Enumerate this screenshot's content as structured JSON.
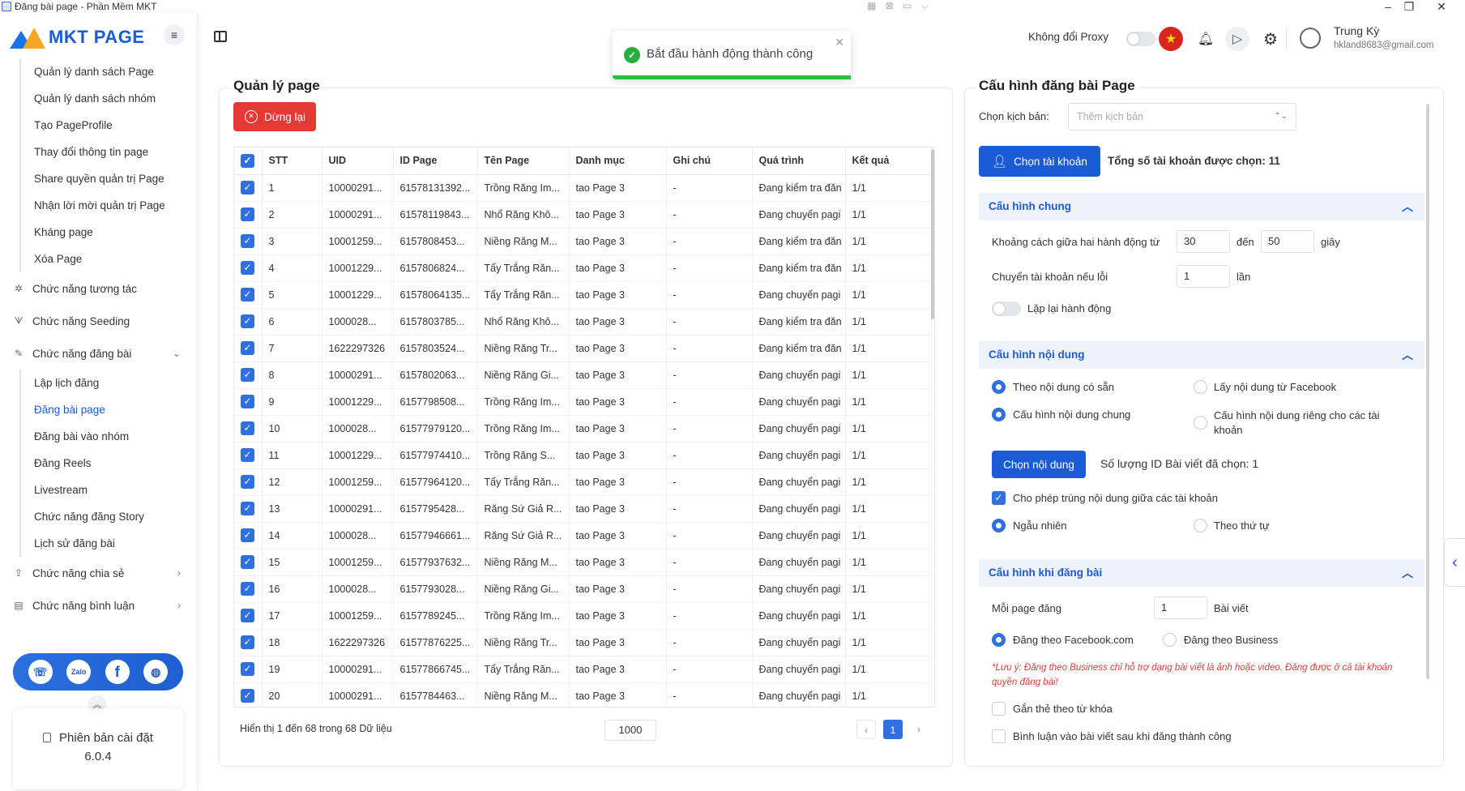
{
  "window": {
    "title": "Đăng bài page - Phần Mềm MKT",
    "minimize": "–",
    "maximize": "❐",
    "close": "✕"
  },
  "sidebar": {
    "logo_text": "MKT PAGE",
    "top_items": [
      {
        "label": "Quản lý danh sách Page"
      },
      {
        "label": "Quản lý danh sách nhóm"
      },
      {
        "label": "Tạo PageProfile"
      },
      {
        "label": "Thay đổi thông tin page"
      },
      {
        "label": "Share quyền quản trị Page"
      },
      {
        "label": "Nhận lời mời quản trị Page"
      },
      {
        "label": "Kháng page"
      },
      {
        "label": "Xóa Page"
      }
    ],
    "groups": {
      "interact": "Chức năng tương tác",
      "seeding": "Chức năng Seeding",
      "posting": "Chức năng đăng bài",
      "share": "Chức năng chia sẻ",
      "comment": "Chức năng bình luận"
    },
    "posting_items": [
      {
        "label": "Lập lịch đăng"
      },
      {
        "label": "Đăng bài page"
      },
      {
        "label": "Đăng bài vào nhóm"
      },
      {
        "label": "Đăng Reels"
      },
      {
        "label": "Livestream"
      },
      {
        "label": "Chức năng đăng Story"
      },
      {
        "label": "Lịch sử đăng bài"
      }
    ],
    "social": {
      "zalo": "Zalo"
    },
    "version_label": "Phiên bản cài đặt",
    "version": "6.0.4"
  },
  "header": {
    "proxy_label": "Không đổi Proxy",
    "user_name": "Trung Kỳ",
    "user_email": "hkland8683@gmail.com"
  },
  "toast": {
    "message": "Bắt đầu hành động thành công",
    "progress": 1.0
  },
  "left_panel": {
    "title": "Quản lý page",
    "stop_button": "Dừng lại",
    "columns": [
      "STT",
      "UID",
      "ID Page",
      "Tên Page",
      "Danh mục",
      "Ghi chú",
      "Quá trình",
      "Kết quả"
    ],
    "rows": [
      [
        "1",
        "10000291...",
        "61578131392...",
        "Trồng Răng Im...",
        "tao Page 3",
        "-",
        "Đang kiểm tra đăn",
        "1/1"
      ],
      [
        "2",
        "10000291...",
        "61578119843...",
        "Nhổ Răng Khô...",
        "tao Page 3",
        "-",
        "Đang chuyển pagi",
        "1/1"
      ],
      [
        "3",
        "10001259...",
        "6157808453...",
        "Niềng Răng M...",
        "tao Page 3",
        "-",
        "Đang kiểm tra đăn",
        "1/1"
      ],
      [
        "4",
        "10001229...",
        "6157806824...",
        "Tẩy Trắng Răn...",
        "tao Page 3",
        "-",
        "Đang kiểm tra đăn",
        "1/1"
      ],
      [
        "5",
        "10001229...",
        "61578064135...",
        "Tẩy Trắng Răn...",
        "tao Page 3",
        "-",
        "Đang chuyển pagi",
        "1/1"
      ],
      [
        "6",
        "1000028...",
        "6157803785...",
        "Nhổ Răng Khô...",
        "tao Page 3",
        "-",
        "Đang kiểm tra đăn",
        "1/1"
      ],
      [
        "7",
        "1622297326",
        "6157803524...",
        "Niềng Răng Tr...",
        "tao Page 3",
        "-",
        "Đang kiểm tra đăn",
        "1/1"
      ],
      [
        "8",
        "10000291...",
        "6157802063...",
        "Niềng Răng Gi...",
        "tao Page 3",
        "-",
        "Đang chuyển pagi",
        "1/1"
      ],
      [
        "9",
        "10001229...",
        "6157798508...",
        "Trồng Răng Im...",
        "tao Page 3",
        "-",
        "Đang chuyển pagi",
        "1/1"
      ],
      [
        "10",
        "1000028...",
        "61577979120...",
        "Trồng Răng Im...",
        "tao Page 3",
        "-",
        "Đang chuyển pagi",
        "1/1"
      ],
      [
        "11",
        "10001229...",
        "61577974410...",
        "Trồng Răng S...",
        "tao Page 3",
        "-",
        "Đang chuyển pagi",
        "1/1"
      ],
      [
        "12",
        "10001259...",
        "61577964120...",
        "Tẩy Trắng Răn...",
        "tao Page 3",
        "-",
        "Đang chuyển pagi",
        "1/1"
      ],
      [
        "13",
        "10000291...",
        "6157795428...",
        "Răng Sứ Giả R...",
        "tao Page 3",
        "-",
        "Đang chuyển pagi",
        "1/1"
      ],
      [
        "14",
        "1000028...",
        "61577946661...",
        "Răng Sứ Giả R...",
        "tao Page 3",
        "-",
        "Đang chuyển pagi",
        "1/1"
      ],
      [
        "15",
        "10001259...",
        "61577937632...",
        "Niềng Răng M...",
        "tao Page 3",
        "-",
        "Đang chuyển pagi",
        "1/1"
      ],
      [
        "16",
        "1000028...",
        "6157793028...",
        "Niềng Răng Gi...",
        "tao Page 3",
        "-",
        "Đang chuyển pagi",
        "1/1"
      ],
      [
        "17",
        "10001259...",
        "6157789245...",
        "Trồng Răng Im...",
        "tao Page 3",
        "-",
        "Đang chuyển pagi",
        "1/1"
      ],
      [
        "18",
        "1622297326",
        "61577876225...",
        "Niềng Răng Tr...",
        "tao Page 3",
        "-",
        "Đang chuyển pagi",
        "1/1"
      ],
      [
        "19",
        "10000291...",
        "61577866745...",
        "Tẩy Trắng Răn...",
        "tao Page 3",
        "-",
        "Đang chuyển pagi",
        "1/1"
      ],
      [
        "20",
        "10000291...",
        "6157784463...",
        "Niềng Răng M...",
        "tao Page 3",
        "-",
        "Đang chuyển pagi",
        "1/1"
      ]
    ],
    "footer_info": "Hiển thị 1 đến 68 trong 68 Dữ liệu",
    "page_size": "1000",
    "current_page": "1",
    "prev": "‹",
    "next": "›"
  },
  "right_panel": {
    "title": "Cấu hình đăng bài Page",
    "script_label": "Chọn kịch bản:",
    "script_placeholder": "Thêm kịch bản",
    "choose_account_button": "Chọn tài khoản",
    "selected_accounts": "Tổng số tài khoản được chọn: 11",
    "general": {
      "title": "Cấu hình chung",
      "interval_label": "Khoảng cách giữa hai hành động từ",
      "interval_from": "30",
      "to_label": "đến",
      "interval_to": "50",
      "seconds_label": "giây",
      "switch_label": "Chuyển tài khoản nếu lỗi",
      "switch_value": "1",
      "times_label": "lần",
      "repeat_label": "Lặp lại hành động"
    },
    "content": {
      "title": "Cấu hình nội dung",
      "opt_existing": "Theo nội dung có sẵn",
      "opt_facebook": "Lấy nội dung từ Facebook",
      "opt_common": "Cấu hình nội dung chung",
      "opt_private": "Cấu hình nội dung riêng cho các tài khoản",
      "choose_content_button": "Chọn nội dung",
      "selected_posts": "Số lượng ID Bài viết đã chọn: 1",
      "allow_duplicate": "Cho phép trùng nội dung giữa các tài khoản",
      "opt_random": "Ngẫu nhiên",
      "opt_order": "Theo thứ tự"
    },
    "posting": {
      "title": "Cấu hình khi đăng bài",
      "per_page_label": "Mỗi page đăng",
      "per_page_value": "1",
      "posts_label": "Bài viết",
      "opt_facebook": "Đăng theo Facebook.com",
      "opt_business": "Đăng theo Business",
      "note": "*Lưu ý: Đăng theo Business chỉ hỗ trợ dạng bài viết là ảnh hoặc video. Đăng được ở cả tài khoản quyền đăng bài!",
      "tag_keyword": "Gắn thẻ theo từ khóa",
      "comment_after": "Bình luận vào bài viết sau khi đăng thành công"
    }
  }
}
